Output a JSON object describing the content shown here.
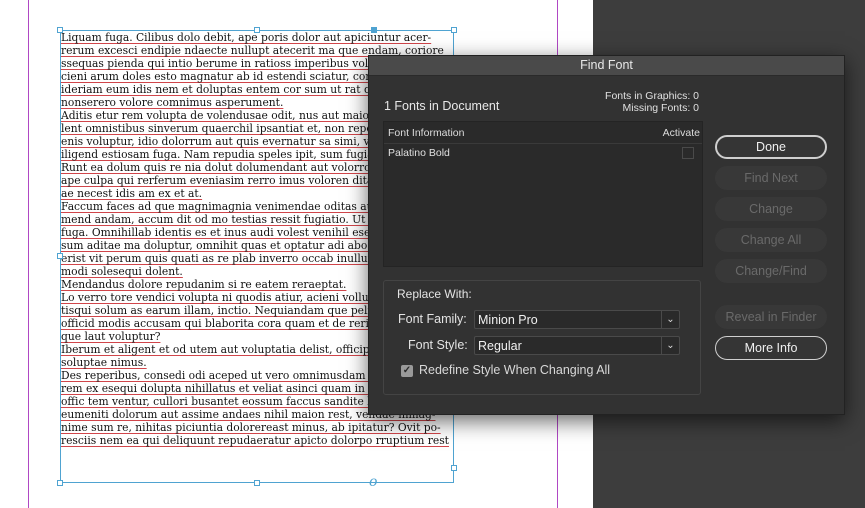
{
  "document": {
    "overset_marker": "o",
    "body_lines": [
      "Liquam fuga. Cilibus dolo debit, ape poris dolor aut apiciuntur acer-",
      "rerum excesci endipie ndaecte nullupt atecerit ma que endam, coriore",
      "ssequas pienda qui intio berume in ratioss imperibus volo",
      "cieni arum doles esto magnatur ab id estendi sciatur, com",
      "ideriam eum idis nem et doluptas entem cor sum ut rat qu",
      "nonserero volore comnimus asperument.",
      "Aditis etur rem volupta de volendusae odit, nus aut maior",
      "lent omnistibus sinverum quaerchil ipsantiat et, non repe",
      "enis voluptur, idio dolorrum aut quis evernatur sa simi, ve",
      "iligend estiosam fuga. Nam repudia speles ipit, sum fugia",
      "Runt ea dolum quis re nia dolut dolumendant aut volorro",
      "ape culpa qui rerferum eveniasim rerro imus voloren dita",
      "ae necest idis am ex et at.",
      "Faccum faces ad que magnimagnia venimendae oditas aut",
      "mend andam, accum dit od mo testias ressit fugiatio. Ut ex",
      "fuga. Omnihillab identis es et inus audi volest venihil ese",
      "sum aditae ma doluptur, omnihit quas et optatur adi abo.",
      "erist vit perum quis quati as re plab inverro occab inullup",
      "modi solesequi dolent.",
      "Mendandus dolore repudanim si re eatem reraeptat.",
      "Lo verro tore vendici volupta ni quodis atiur, acieni vollup",
      "tisqui solum as earum illam, inctio. Nequiandam que peli",
      "officid modis accusam qui blaborita cora quam et de rerior",
      "que laut voluptur?",
      "Iberum et aligent et od utem aut voluptatia delist, officip s",
      "soluptae nimus.",
      "Des reperibus, consedi odi aceped ut vero omnimusdam f",
      "rem ex esequi dolupta nihillatus et veliat asinci quam in et plictor acit",
      "offic tem ventur, cullori busantet eossum faccus sandite lacesci taturest",
      "eumeniti dolorum aut assime andaes nihil maion rest, vendae nimag-",
      "nime sum re, nihitas piciuntia dolorereast minus, ab ipitatur? Ovit po-",
      "resciis nem ea qui deliquunt repudaeratur apicto dolorpo rruptium rest"
    ]
  },
  "dialog": {
    "title": "Find Font",
    "fonts_in_document": "1 Fonts in Document",
    "fonts_in_graphics": "Fonts in Graphics: 0",
    "missing_fonts": "Missing Fonts: 0",
    "table": {
      "col_info": "Font Information",
      "col_activate": "Activate",
      "rows": [
        {
          "name": "Palatino Bold",
          "activate": false
        }
      ]
    },
    "replace": {
      "title": "Replace With:",
      "family_label": "Font Family:",
      "family_value": "Minion Pro",
      "style_label": "Font Style:",
      "style_value": "Regular",
      "redefine_label": "Redefine Style When Changing All",
      "redefine_checked": true
    },
    "buttons": {
      "done": "Done",
      "find_next": "Find Next",
      "change": "Change",
      "change_all": "Change All",
      "change_find": "Change/Find",
      "reveal": "Reveal in Finder",
      "more_info": "More Info"
    }
  },
  "colors": {
    "frame_accent": "#4fa3d1",
    "margin_guide": "#b048c4",
    "spell_underline": "#d0454a",
    "dialog_bg": "#323232"
  }
}
